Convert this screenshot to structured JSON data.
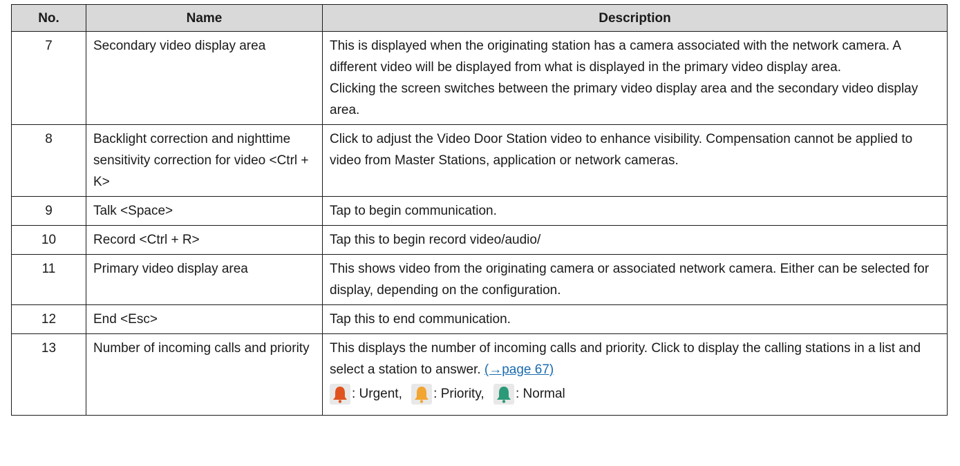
{
  "headers": {
    "no": "No.",
    "name": "Name",
    "description": "Description"
  },
  "rows": [
    {
      "no": "7",
      "name": "Secondary video display area",
      "description_lines": [
        "This is displayed when the originating station has a camera associated with the network camera. A different video will be displayed from what is displayed in the primary video display area.",
        "Clicking the screen switches between the primary video display area and the secondary video display area."
      ]
    },
    {
      "no": "8",
      "name": "Backlight correction and nighttime sensitivity correction for video <Ctrl + K>",
      "description_lines": [
        "Click to adjust the Video Door Station video to enhance visibility. Compensation cannot be applied to video from Master Stations, application or network cameras."
      ]
    },
    {
      "no": "9",
      "name": "Talk <Space>",
      "description_lines": [
        "Tap to begin communication."
      ]
    },
    {
      "no": "10",
      "name": "Record <Ctrl + R>",
      "description_lines": [
        "Tap this to begin record video/audio/"
      ]
    },
    {
      "no": "11",
      "name": "Primary video display area",
      "description_lines": [
        "This shows video from the originating camera or associated network camera. Either can be selected for display, depending on the configuration."
      ]
    },
    {
      "no": "12",
      "name": "End <Esc>",
      "description_lines": [
        "Tap this to end communication."
      ]
    },
    {
      "no": "13",
      "name": "Number of incoming calls and priority",
      "description_lines": [
        "This displays the number of incoming calls and priority. Click to display the calling stations in a list and select a station to answer."
      ],
      "link_text": "(→page 67)",
      "priority_legend": [
        {
          "icon": "bell-urgent-icon",
          "color": "#e0531e",
          "label": ": Urgent,"
        },
        {
          "icon": "bell-priority-icon",
          "color": "#f2a530",
          "label": ": Priority,"
        },
        {
          "icon": "bell-normal-icon",
          "color": "#2b9a78",
          "label": ": Normal"
        }
      ]
    }
  ]
}
